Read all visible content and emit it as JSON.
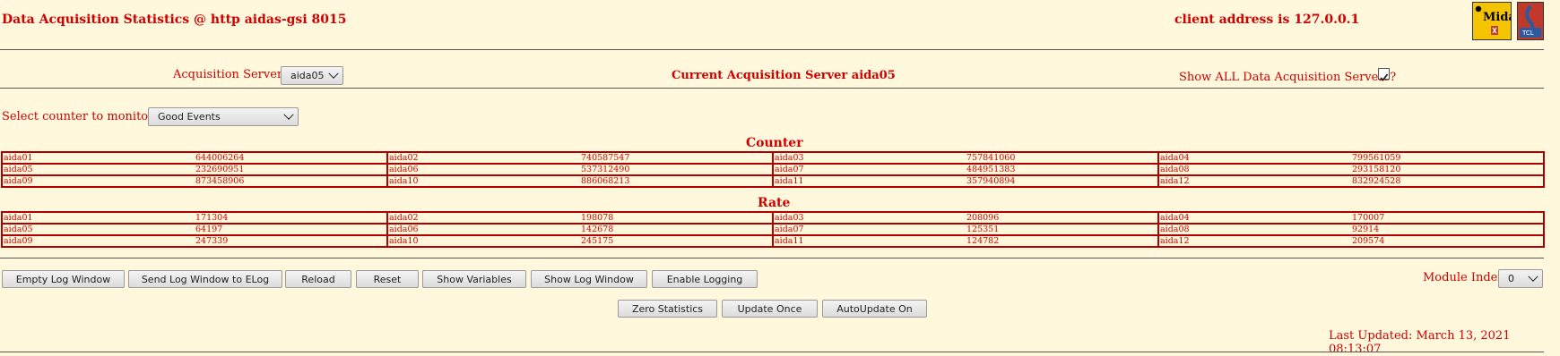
{
  "header": {
    "title": "Data Acquisition Statistics @ http aidas-gsi 8015",
    "client": "client address is 127.0.0.1",
    "midas_logo": "Midas",
    "tcl_logo": "TCL"
  },
  "servers": {
    "label": "Acquisition Servers",
    "selected": "aida05",
    "current": "Current Acquisition Server aida05",
    "show_all_label": "Show ALL Data Acquisition Servers?",
    "show_all_checked": true
  },
  "counter_select": {
    "label": "Select counter to monitor",
    "selected": "Good Events"
  },
  "counter": {
    "heading": "Counter",
    "rows": [
      [
        [
          "aida01",
          "644006264"
        ],
        [
          "aida02",
          "740587547"
        ],
        [
          "aida03",
          "757841060"
        ],
        [
          "aida04",
          "799561059"
        ]
      ],
      [
        [
          "aida05",
          "232690951"
        ],
        [
          "aida06",
          "537312490"
        ],
        [
          "aida07",
          "484951383"
        ],
        [
          "aida08",
          "293158120"
        ]
      ],
      [
        [
          "aida09",
          "873458906"
        ],
        [
          "aida10",
          "886068213"
        ],
        [
          "aida11",
          "357940894"
        ],
        [
          "aida12",
          "832924528"
        ]
      ]
    ]
  },
  "rate": {
    "heading": "Rate",
    "rows": [
      [
        [
          "aida01",
          "171304"
        ],
        [
          "aida02",
          "198078"
        ],
        [
          "aida03",
          "208096"
        ],
        [
          "aida04",
          "170007"
        ]
      ],
      [
        [
          "aida05",
          "64197"
        ],
        [
          "aida06",
          "142678"
        ],
        [
          "aida07",
          "125351"
        ],
        [
          "aida08",
          "92914"
        ]
      ],
      [
        [
          "aida09",
          "247339"
        ],
        [
          "aida10",
          "245175"
        ],
        [
          "aida11",
          "124782"
        ],
        [
          "aida12",
          "209574"
        ]
      ]
    ]
  },
  "buttons": {
    "empty_log": "Empty Log Window",
    "send_log": "Send Log Window to ELog",
    "reload": "Reload",
    "reset": "Reset",
    "show_variables": "Show Variables",
    "show_log": "Show Log Window",
    "enable_logging": "Enable Logging",
    "zero_stats": "Zero Statistics",
    "update_once": "Update Once",
    "autoupdate": "AutoUpdate On"
  },
  "module_index": {
    "label": "Module Index",
    "selected": "0"
  },
  "footer": {
    "last_updated": "Last Updated: March 13, 2021 08:13:07"
  },
  "colors": {
    "background": "#fff8dc",
    "text": "#d00000",
    "table_border": "#b00000"
  }
}
